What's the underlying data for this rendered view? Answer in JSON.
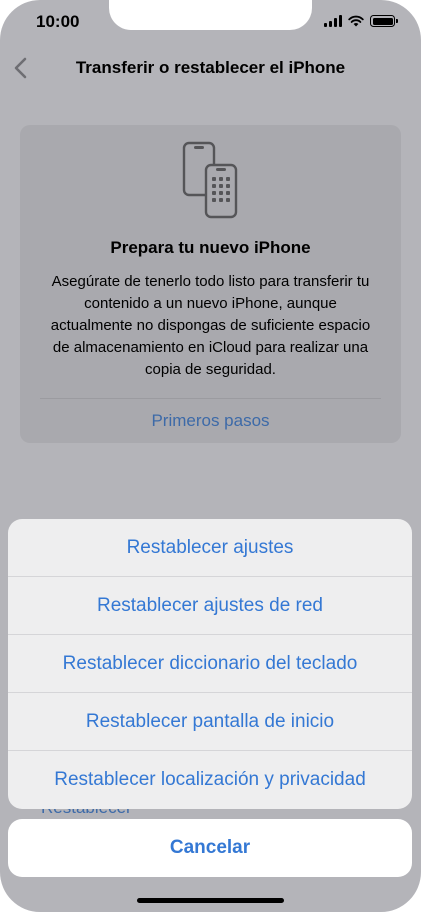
{
  "status_bar": {
    "time": "10:00",
    "icons": [
      "cellular-signal-icon",
      "wifi-icon",
      "battery-icon"
    ]
  },
  "nav": {
    "back_icon": "chevron-left-icon",
    "title": "Transferir o restablecer el iPhone"
  },
  "card": {
    "icon": "two-phones-icon",
    "title": "Prepara tu nuevo iPhone",
    "body": "Asegúrate de tenerlo todo listo para transferir tu contenido a un nuevo iPhone, aunque actualmente no dispongas de suficiente espacio de almacenamiento en iCloud para realizar una copia de seguridad.",
    "link": "Primeros pasos"
  },
  "behind_sheet_text": "Restablecer",
  "action_sheet": {
    "items": [
      {
        "label": "Restablecer ajustes"
      },
      {
        "label": "Restablecer ajustes de red"
      },
      {
        "label": "Restablecer diccionario del teclado"
      },
      {
        "label": "Restablecer pantalla de inicio"
      },
      {
        "label": "Restablecer localización y privacidad"
      }
    ],
    "cancel_label": "Cancelar"
  },
  "colors": {
    "dim_background": "#b4b4b9",
    "card_background": "#a9a9ae",
    "action_blue": "#3478d4",
    "dimmed_link_blue": "#3d6aa8",
    "sheet_background": "#eeeeef"
  }
}
